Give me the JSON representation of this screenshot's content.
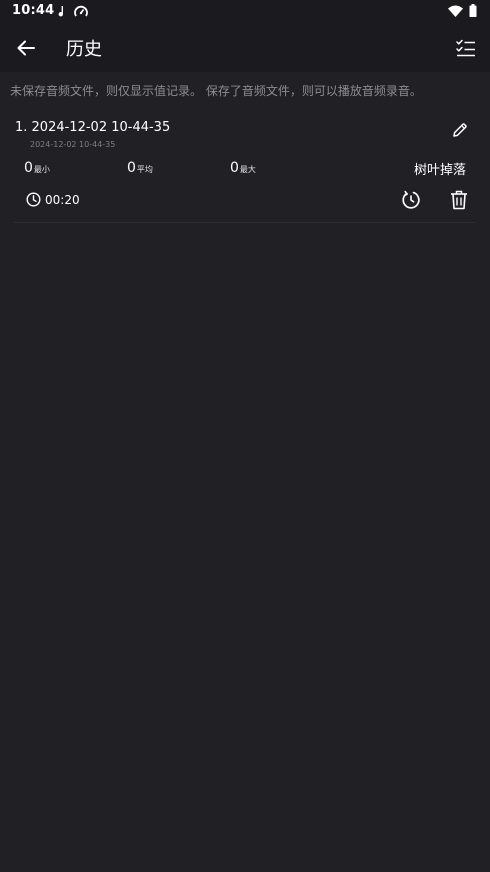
{
  "status_bar": {
    "time": "10:44",
    "icons": [
      "music-note-icon",
      "speedometer-icon",
      "wifi-icon",
      "battery-icon"
    ]
  },
  "app_bar": {
    "title": "历史",
    "back_icon": "arrow-left-icon",
    "action_icon": "checklist-icon"
  },
  "info_text": "未保存音频文件，则仅显示值记录。 保存了音频文件，则可以播放音频录音。",
  "records": [
    {
      "title": "1. 2024-12-02 10-44-35",
      "subtitle": "2024-12-02 10-44-35",
      "stats": {
        "min": {
          "value": "0",
          "label": "最小"
        },
        "avg": {
          "value": "0",
          "label": "平均"
        },
        "max": {
          "value": "0",
          "label": "最大"
        }
      },
      "category": "树叶掉落",
      "duration": "00:20"
    }
  ],
  "colors": {
    "background": "#212025",
    "bar": "#1b1a1f",
    "text": "#ffffff",
    "muted": "#8d8c92"
  }
}
